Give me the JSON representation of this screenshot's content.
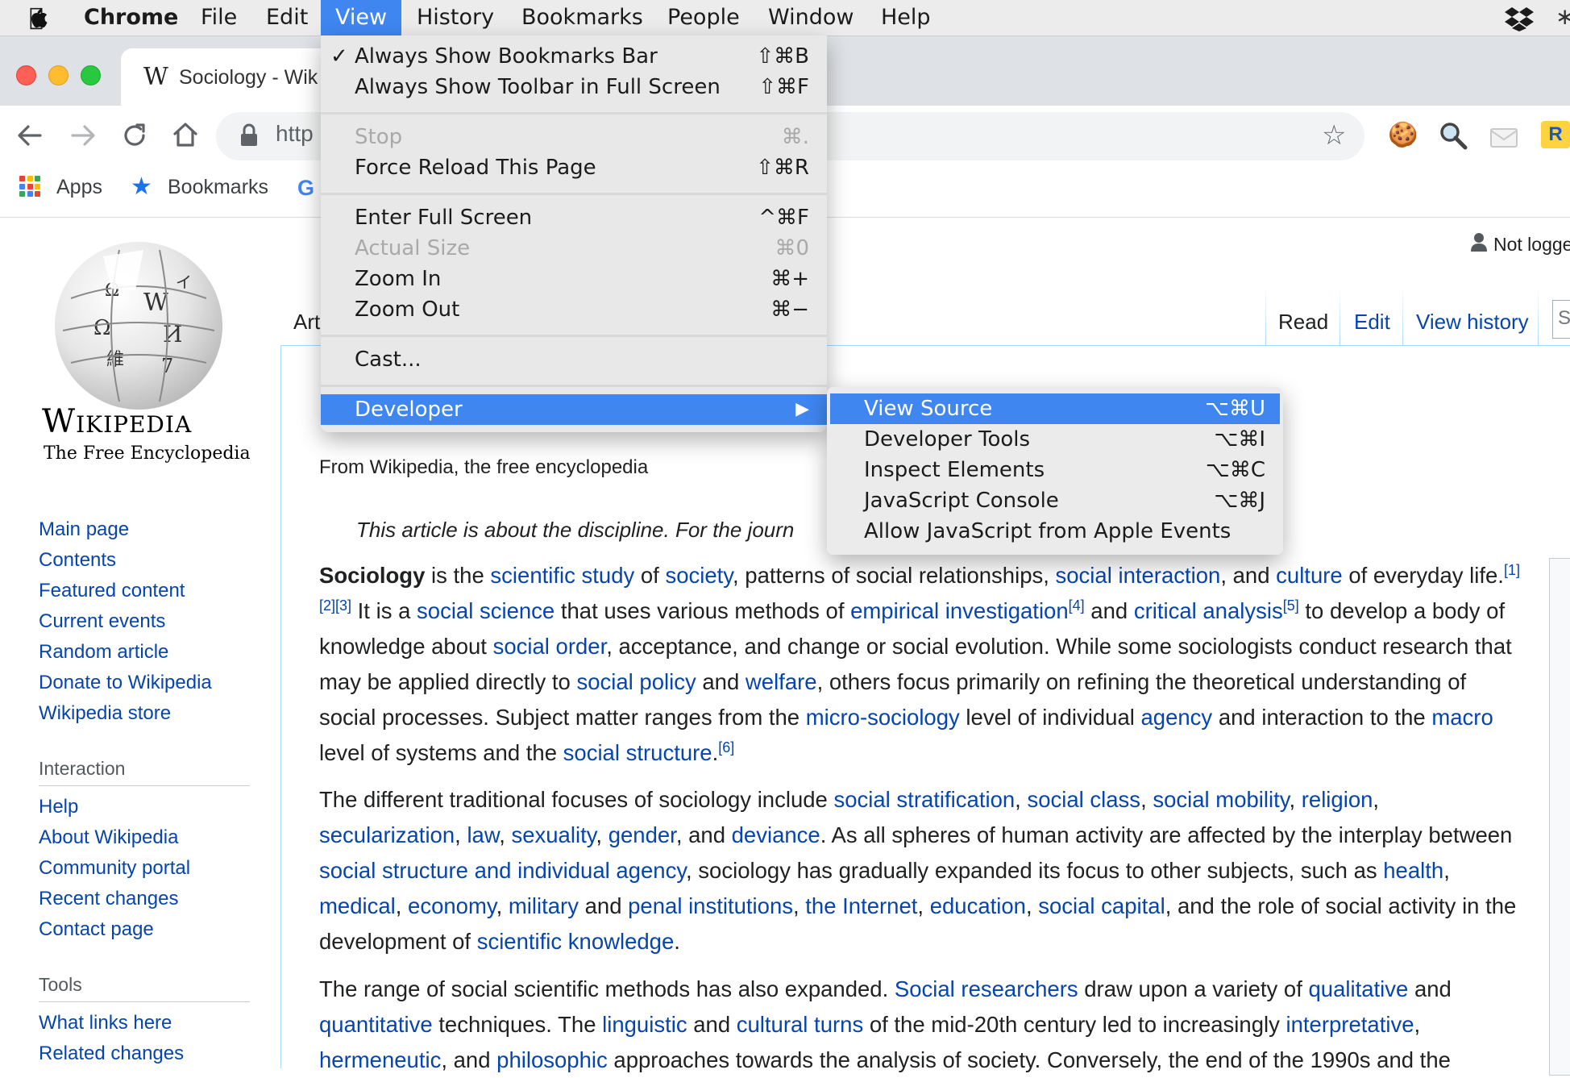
{
  "menubar": {
    "apple": "",
    "items": [
      "Chrome",
      "File",
      "Edit",
      "View",
      "History",
      "Bookmarks",
      "People",
      "Window",
      "Help"
    ]
  },
  "tab": {
    "title": "Sociology - Wik",
    "favicon": "W"
  },
  "omnibox": {
    "url": "http"
  },
  "bookmarks": {
    "apps": "Apps",
    "bookmarks": "Bookmarks"
  },
  "view_menu": {
    "items": [
      {
        "label": "Always Show Bookmarks Bar",
        "shortcut": "⇧⌘B",
        "checked": "✓"
      },
      {
        "label": "Always Show Toolbar in Full Screen",
        "shortcut": "⇧⌘F"
      },
      {
        "label": "Stop",
        "shortcut": "⌘.",
        "disabled": true
      },
      {
        "label": "Force Reload This Page",
        "shortcut": "⇧⌘R"
      },
      {
        "label": "Enter Full Screen",
        "shortcut": "^⌘F"
      },
      {
        "label": "Actual Size",
        "shortcut": "⌘0",
        "disabled": true
      },
      {
        "label": "Zoom In",
        "shortcut": "⌘+"
      },
      {
        "label": "Zoom Out",
        "shortcut": "⌘−"
      },
      {
        "label": "Cast..."
      },
      {
        "label": "Developer",
        "submenu_arrow": "▶"
      }
    ]
  },
  "developer_menu": {
    "items": [
      {
        "label": "View Source",
        "shortcut": "⌥⌘U"
      },
      {
        "label": "Developer Tools",
        "shortcut": "⌥⌘I"
      },
      {
        "label": "Inspect Elements",
        "shortcut": "⌥⌘C"
      },
      {
        "label": "JavaScript Console",
        "shortcut": "⌥⌘J"
      },
      {
        "label": "Allow JavaScript from Apple Events"
      }
    ]
  },
  "wiki": {
    "wordmark": "Wikipedia",
    "tagline": "The Free Encyclopedia",
    "nav_main": [
      "Main page",
      "Contents",
      "Featured content",
      "Current events",
      "Random article",
      "Donate to Wikipedia",
      "Wikipedia store"
    ],
    "interaction_heading": "Interaction",
    "nav_interaction": [
      "Help",
      "About Wikipedia",
      "Community portal",
      "Recent changes",
      "Contact page"
    ],
    "tools_heading": "Tools",
    "nav_tools": [
      "What links here",
      "Related changes"
    ],
    "not_logged": "Not logge",
    "tab_article": "Art",
    "tab_read": "Read",
    "tab_edit": "Edit",
    "tab_history": "View history",
    "search_stub": "S",
    "from_wikipedia": "From Wikipedia, the free encyclopedia",
    "hatnote": "This article is about the discipline. For the journ"
  },
  "colors": {
    "link": "#0645ad",
    "menu_highlight": "#3f86f1"
  }
}
